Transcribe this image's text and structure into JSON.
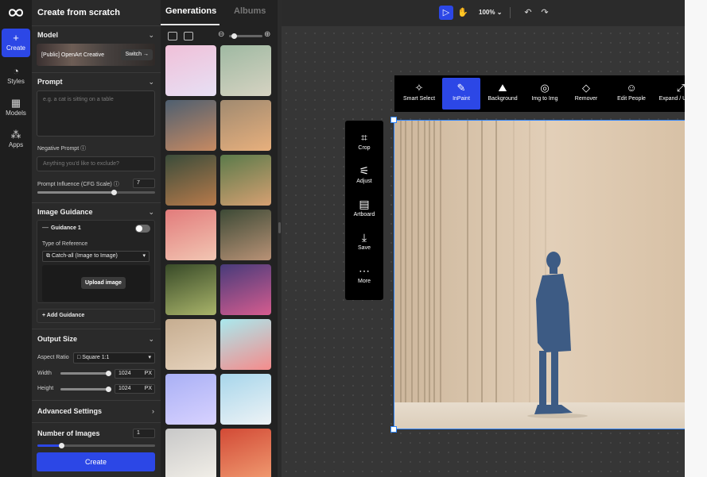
{
  "nav": {
    "items": [
      {
        "label": "Create",
        "icon": "plus-icon"
      },
      {
        "label": "Styles",
        "icon": "palette-icon"
      },
      {
        "label": "Models",
        "icon": "grid-icon"
      },
      {
        "label": "Apps",
        "icon": "apps-icon"
      }
    ]
  },
  "panel": {
    "title": "Create from scratch",
    "model": {
      "title": "Model",
      "name": "[Public] OpenArt Creative",
      "switch_label": "Switch →"
    },
    "prompt": {
      "title": "Prompt",
      "placeholder": "e.g. a cat is sitting on a table"
    },
    "negative_prompt": {
      "label": "Negative Prompt ⓘ",
      "placeholder": "Anything you'd like to exclude?"
    },
    "cfg": {
      "label": "Prompt Influence (CFG Scale) ⓘ",
      "value": "7",
      "level": 0.65
    },
    "image_guidance": {
      "title": "Image Guidance",
      "guidance_label": "Guidance 1",
      "type_label": "Type of Reference",
      "type_value": "Catch-all (Image to Image)",
      "upload_label": "Upload image",
      "add_label": "Add Guidance"
    },
    "output": {
      "title": "Output Size",
      "aspect_label": "Aspect Ratio",
      "aspect_value": "Square 1:1",
      "width_label": "Width",
      "width_value": "1024",
      "height_label": "Height",
      "height_value": "1024",
      "unit": "PX"
    },
    "advanced": {
      "title": "Advanced Settings"
    },
    "num_images": {
      "title": "Number of Images",
      "value": "1",
      "level": 0.2
    },
    "create_label": "Create"
  },
  "gallery": {
    "tabs": [
      "Generations",
      "Albums"
    ],
    "active_tab": "Generations",
    "thumbs": [
      {
        "name": "pink-character",
        "colors": [
          "#f0c0d8",
          "#e7e0f5"
        ]
      },
      {
        "name": "motorcycle-girl",
        "colors": [
          "#9fb9a2",
          "#d6d3c2"
        ]
      },
      {
        "name": "old-man-cartoon",
        "colors": [
          "#4e5f70",
          "#c78a62"
        ]
      },
      {
        "name": "orange-cat",
        "colors": [
          "#a08a70",
          "#e8b07d"
        ]
      },
      {
        "name": "cats-at-window",
        "colors": [
          "#3a4c3a",
          "#b77a4b"
        ]
      },
      {
        "name": "braided-girl",
        "colors": [
          "#5a7a4a",
          "#d6a072"
        ]
      },
      {
        "name": "pink-landscape",
        "colors": [
          "#e27b7b",
          "#f2c6b3"
        ]
      },
      {
        "name": "woman-portrait",
        "colors": [
          "#3d4a36",
          "#b99276"
        ]
      },
      {
        "name": "elf-warrior",
        "colors": [
          "#384a28",
          "#a9b46a"
        ]
      },
      {
        "name": "lego-scene",
        "colors": [
          "#473b7a",
          "#d65c8f"
        ]
      },
      {
        "name": "man-in-room",
        "colors": [
          "#c6ad90",
          "#e6d3bd"
        ]
      },
      {
        "name": "pink-creature",
        "colors": [
          "#a9e9ee",
          "#f58b8b"
        ]
      },
      {
        "name": "space-doodle",
        "colors": [
          "#a9b0f5",
          "#d8d2ff"
        ]
      },
      {
        "name": "seal-cartoon",
        "colors": [
          "#a7d6eb",
          "#eef3f6"
        ]
      },
      {
        "name": "anime-girl",
        "colors": [
          "#c8c8c8",
          "#f2efe8"
        ]
      },
      {
        "name": "red-landscape",
        "colors": [
          "#d24a36",
          "#f09a70"
        ]
      }
    ]
  },
  "canvas": {
    "zoom": "100%",
    "side_tools": [
      {
        "label": "Crop",
        "icon": "crop-icon"
      },
      {
        "label": "Adjust",
        "icon": "sliders-icon"
      },
      {
        "label": "Artboard",
        "icon": "artboard-icon"
      },
      {
        "label": "Save",
        "icon": "download-icon"
      },
      {
        "label": "More",
        "icon": "more-icon"
      }
    ],
    "edit_tools": [
      {
        "label": "Smart Select",
        "icon": "sparkle-select-icon"
      },
      {
        "label": "InPaint",
        "icon": "brush-icon",
        "active": true
      },
      {
        "label": "Background",
        "icon": "background-icon"
      },
      {
        "label": "Img to Img",
        "icon": "img2img-icon"
      },
      {
        "label": "Remover",
        "icon": "eraser-icon"
      },
      {
        "label": "Edit People",
        "icon": "person-icon"
      },
      {
        "label": "Expand / Upscale",
        "icon": "expand-icon"
      }
    ]
  },
  "colors": {
    "accent": "#2c47e6",
    "selection": "#2f86ff"
  }
}
